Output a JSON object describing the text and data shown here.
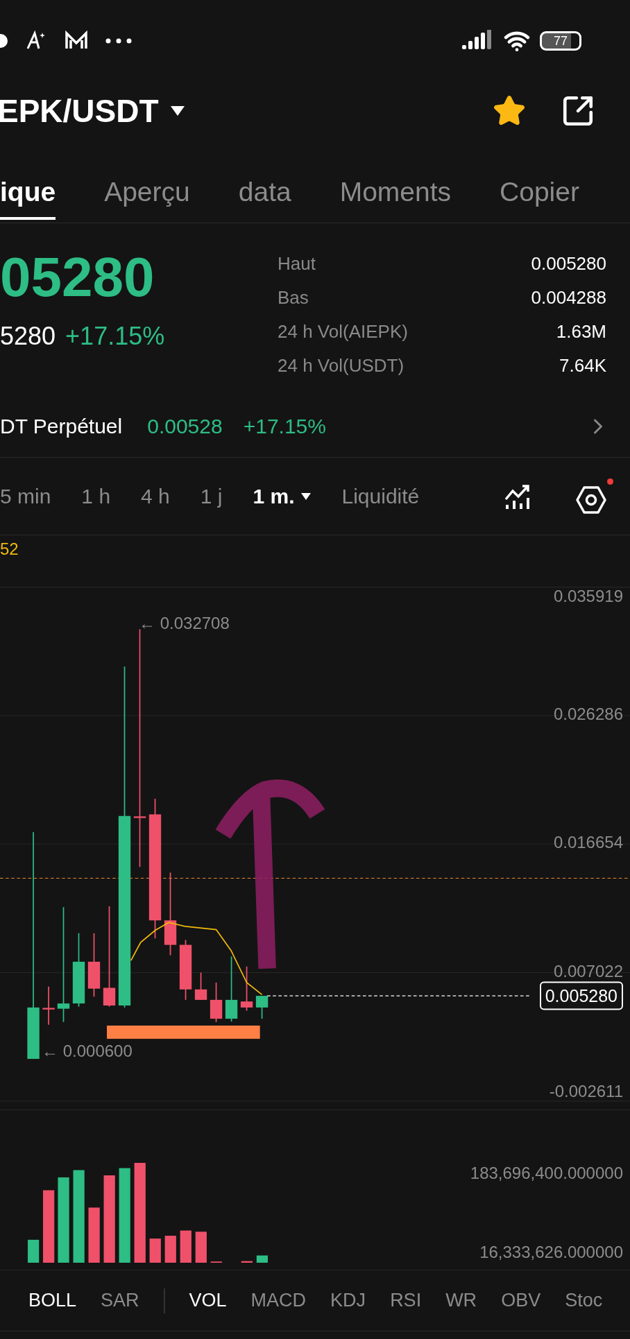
{
  "status_bar": {
    "battery": "77"
  },
  "header": {
    "pair": "EPK/USDT",
    "favorite": true
  },
  "tabs": [
    {
      "label": "ique",
      "selected": true
    },
    {
      "label": "Aperçu",
      "selected": false
    },
    {
      "label": "data",
      "selected": false
    },
    {
      "label": "Moments",
      "selected": false
    },
    {
      "label": "Copier",
      "selected": false
    }
  ],
  "price": {
    "last": "05280",
    "converted": "5280",
    "change": "+17.15%"
  },
  "stats": [
    {
      "label": "Haut",
      "value": "0.005280"
    },
    {
      "label": "Bas",
      "value": "0.004288"
    },
    {
      "label": "24 h Vol(AIEPK)",
      "value": "1.63M"
    },
    {
      "label": "24 h Vol(USDT)",
      "value": "7.64K"
    }
  ],
  "perpetual": {
    "name": "DT Perpétuel",
    "price": "0.00528",
    "change": "+17.15%"
  },
  "timeframes": [
    {
      "label": "5 min",
      "selected": false,
      "menu": false
    },
    {
      "label": "1 h",
      "selected": false,
      "menu": false
    },
    {
      "label": "4 h",
      "selected": false,
      "menu": false
    },
    {
      "label": "1 j",
      "selected": false,
      "menu": false
    },
    {
      "label": "1 m.",
      "selected": true,
      "menu": true
    },
    {
      "label": "Liquidité",
      "selected": false,
      "menu": false
    }
  ],
  "settings_alert": true,
  "chart": {
    "indicator": "52",
    "axis": [
      "0.035919",
      "0.026286",
      "0.016654",
      "0.007022",
      "-0.002611"
    ],
    "high": "← 0.032708",
    "low": "← 0.000600",
    "last_price": "0.005280"
  },
  "volume": {
    "axis": [
      "183,696,400.000000",
      "16,333,626.000000"
    ]
  },
  "main_indicators": [
    {
      "label": "BOLL",
      "selected": true
    },
    {
      "label": "SAR",
      "selected": false
    }
  ],
  "sub_indicators": [
    {
      "label": "VOL",
      "selected": true
    },
    {
      "label": "MACD",
      "selected": false
    },
    {
      "label": "KDJ",
      "selected": false
    },
    {
      "label": "RSI",
      "selected": false
    },
    {
      "label": "WR",
      "selected": false
    },
    {
      "label": "OBV",
      "selected": false
    },
    {
      "label": "Stoc",
      "selected": false
    }
  ]
}
